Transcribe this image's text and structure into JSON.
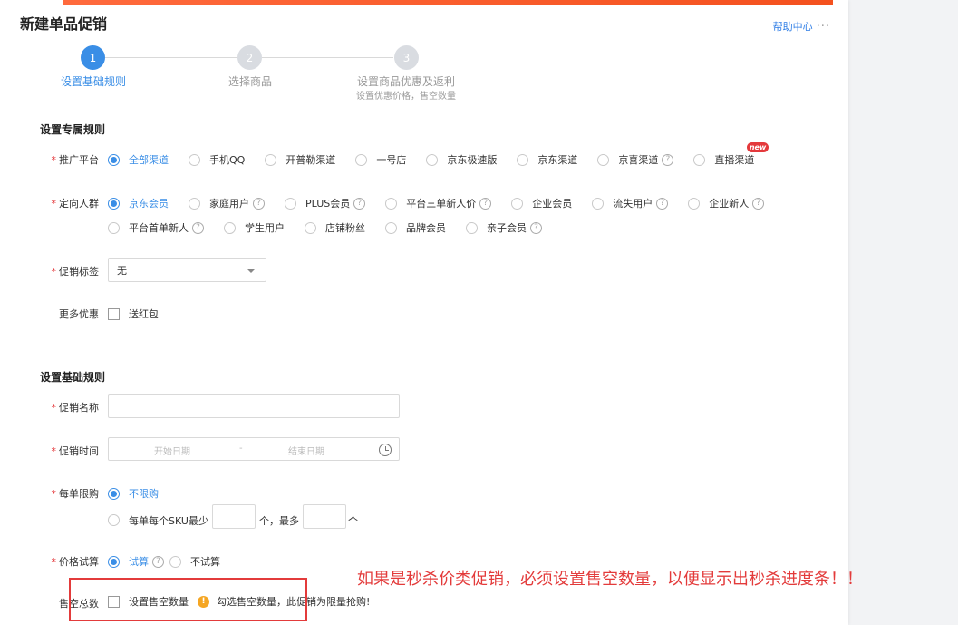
{
  "header": {
    "title": "新建单品促销",
    "help_label": "帮助中心",
    "more": "···"
  },
  "steps": [
    {
      "num": "1",
      "label": "设置基础规则",
      "sub": "",
      "active": true
    },
    {
      "num": "2",
      "label": "选择商品",
      "sub": "",
      "active": false
    },
    {
      "num": "3",
      "label": "设置商品优惠及返利",
      "sub": "设置优惠价格，售空数量",
      "active": false
    }
  ],
  "section1": {
    "title": "设置专属规则",
    "platform": {
      "label": "推广平台",
      "options": [
        "全部渠道",
        "手机QQ",
        "开普勒渠道",
        "一号店",
        "京东极速版",
        "京东渠道",
        "京喜渠道",
        "直播渠道"
      ],
      "new_badge": "new"
    },
    "audience": {
      "label": "定向人群",
      "row1": [
        "京东会员",
        "家庭用户",
        "PLUS会员",
        "平台三单新人价",
        "企业会员",
        "流失用户",
        "企业新人"
      ],
      "row2": [
        "平台首单新人",
        "学生用户",
        "店铺粉丝",
        "品牌会员",
        "亲子会员"
      ]
    },
    "tag": {
      "label": "促销标签",
      "value": "无"
    },
    "more": {
      "label": "更多优惠",
      "option": "送红包"
    }
  },
  "section2": {
    "title": "设置基础规则",
    "name": {
      "label": "促销名称",
      "value": ""
    },
    "time": {
      "label": "促销时间",
      "start_placeholder": "开始日期",
      "separator": "-",
      "end_placeholder": "结束日期"
    },
    "limit": {
      "label": "每单限购",
      "option_unlimited": "不限购",
      "option_custom_prefix": "每单每个SKU最少",
      "unit1": "个，最多",
      "unit2": "个"
    },
    "trial": {
      "label": "价格试算",
      "option_yes": "试算",
      "option_no": "不试算"
    },
    "sellout": {
      "label": "售空总数",
      "option": "设置售空数量",
      "warn_icon": "!",
      "hint": "勾选售空数量，此促销为限量抢购!"
    }
  },
  "annotation": {
    "text": "如果是秒杀价类促销，必须设置售空数量，以便显示出秒杀进度条！！"
  },
  "colors": {
    "accent": "#3a8ee6",
    "required": "#e4393c",
    "annotation": "#e33b3b",
    "warning": "#f5a623"
  }
}
